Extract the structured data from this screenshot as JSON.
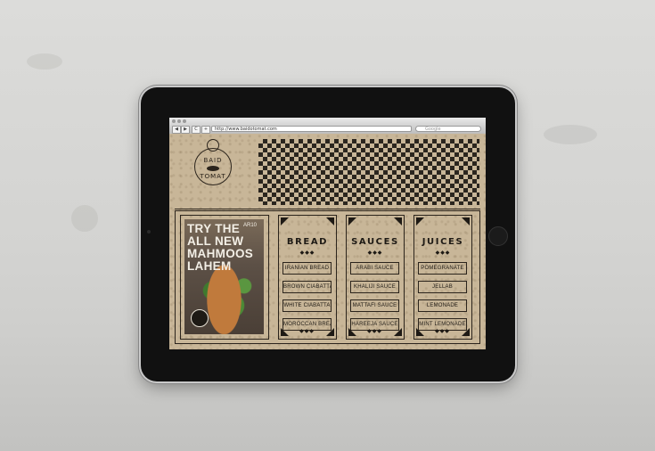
{
  "browser": {
    "url": "http://www.baidotomat.com",
    "search_placeholder": "Google",
    "back": "◀",
    "forward": "▶",
    "reload": "C",
    "add": "+"
  },
  "logo": {
    "top": "BAID",
    "bottom": "TOMAT"
  },
  "promo": {
    "headline": "TRY THE ALL NEW MAHMOOS LAHEM",
    "price": "AR10"
  },
  "columns": [
    {
      "title": "BREAD",
      "items": [
        "IRANIAN BREAD",
        "BROWN CIABATTA",
        "WHITE CIABATTA",
        "MOROCCAN BREAD"
      ]
    },
    {
      "title": "SAUCES",
      "items": [
        "ARABI SAUCE",
        "KHALIJI SAUCE",
        "MATTAFI SAUCE",
        "HAREEJA SAUCE"
      ]
    },
    {
      "title": "JUICES",
      "items": [
        "POMEGRANATE",
        "JELLAB",
        "LEMONADE",
        "MINT LEMONADE"
      ]
    }
  ],
  "ornament": "◆◆◆",
  "colors": {
    "paper": "#c8b698",
    "ink": "#1e1a15",
    "bezel": "#111111"
  }
}
